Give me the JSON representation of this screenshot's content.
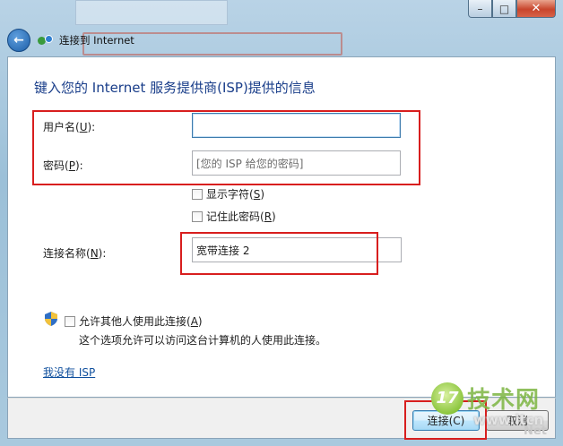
{
  "window": {
    "title": "连接到 Internet",
    "caption": {
      "minimize": "–",
      "maximize": "□",
      "close": "✕"
    }
  },
  "page": {
    "heading": "键入您的 Internet 服务提供商(ISP)提供的信息"
  },
  "form": {
    "username": {
      "label_pre": "用户名(",
      "label_key": "U",
      "label_post": "):",
      "value": ""
    },
    "password": {
      "label_pre": "密码(",
      "label_key": "P",
      "label_post": "):",
      "placeholder": "[您的 ISP 给您的密码]"
    },
    "show_chars": {
      "label_pre": "显示字符(",
      "label_key": "S",
      "label_post": ")",
      "checked": false
    },
    "remember": {
      "label_pre": "记住此密码(",
      "label_key": "R",
      "label_post": ")",
      "checked": false
    },
    "conn_name": {
      "label_pre": "连接名称(",
      "label_key": "N",
      "label_post": "):",
      "value": "宽带连接 2"
    },
    "allow_others": {
      "label_pre": "允许其他人使用此连接(",
      "label_key": "A",
      "label_post": ")",
      "checked": false
    },
    "allow_note": "这个选项允许可以访问这台计算机的人使用此连接。",
    "no_isp_link": "我没有 ISP"
  },
  "footer": {
    "connect_label": "连接(C)",
    "cancel_label": "取消"
  },
  "watermark": {
    "logo_glyph": "17",
    "brand": "技术网",
    "url": "www.itcn",
    "url2": "Net"
  },
  "colors": {
    "highlight_box": "#d81e1e",
    "heading": "#1a3e8a",
    "link": "#0f4f9d"
  }
}
